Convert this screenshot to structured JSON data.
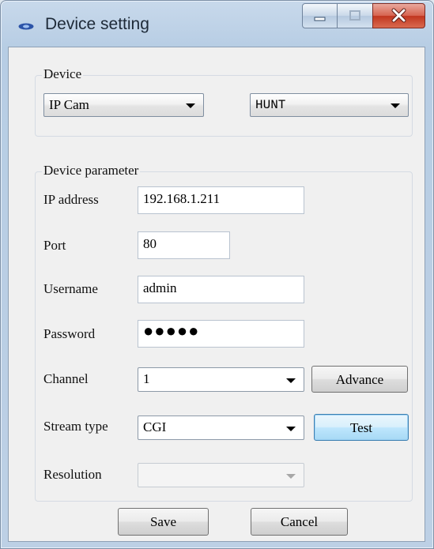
{
  "window": {
    "title": "Device setting"
  },
  "device": {
    "legend": "Device",
    "type_selected": "IP Cam",
    "brand_selected": "HUNT"
  },
  "params": {
    "legend": "Device parameter",
    "ip_label": "IP address",
    "ip_value": "192.168.1.211",
    "port_label": "Port",
    "port_value": "80",
    "username_label": "Username",
    "username_value": "admin",
    "password_label": "Password",
    "password_mask": "●●●●●",
    "channel_label": "Channel",
    "channel_selected": "1",
    "advance_label": "Advance",
    "stream_label": "Stream type",
    "stream_selected": "CGI",
    "test_label": "Test",
    "resolution_label": "Resolution",
    "resolution_selected": ""
  },
  "footer": {
    "save_label": "Save",
    "cancel_label": "Cancel"
  },
  "icons": {
    "app": "device-eye-icon",
    "minimize": "minimize-icon",
    "maximize": "maximize-icon",
    "close": "close-icon"
  }
}
